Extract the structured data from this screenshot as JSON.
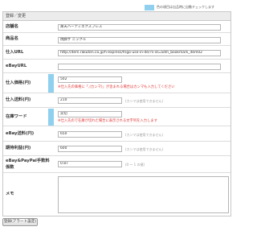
{
  "legend": {
    "text": "色の項目は出品時に自動チェックします"
  },
  "panel": {
    "title": "登録／変更"
  },
  "fields": {
    "shop_name": {
      "label": "店舗名",
      "value": "楽天ハーティエクスプレス"
    },
    "product_name": {
      "label": "商品名",
      "value": "焼豚ザ ニックル"
    },
    "purchase_url": {
      "label": "仕入URL",
      "value": "http://item.rakuten.co.jp/h-express/frigo-use-in-de/?s-id=adm_bookmark_item02"
    },
    "ebay_url": {
      "label": "eBayURL",
      "value": ""
    },
    "purchase_price": {
      "label": "仕入価格(円)",
      "value": "502",
      "error": "※仕入先の価格に「,(カンマ)」が含まれる場合はカンマも入力してください"
    },
    "purchase_shipping": {
      "label": "仕入送料(円)",
      "value": "210",
      "note": "(カンマは使用できません)"
    },
    "stock_word": {
      "label": "在庫ワード",
      "value": "売切",
      "error": "※仕入先ので在庫が切れた場合に表示される文字列を入力します"
    },
    "ebay_shipping": {
      "label": "eBay送料(円)",
      "value": "650",
      "note": "(カンマは使用できません)"
    },
    "expected_profit": {
      "label": "期待利益(円)",
      "value": "600",
      "note": "(カンマは使用できません)"
    },
    "fee_rate": {
      "label": "eBay&PayPal手数料係数",
      "value": "0.87",
      "note": "(0 ～ 1 の値)"
    },
    "memo": {
      "label": "メモ",
      "value": ""
    }
  },
  "buttons": {
    "submit_label": "登録(アラート設定)"
  }
}
